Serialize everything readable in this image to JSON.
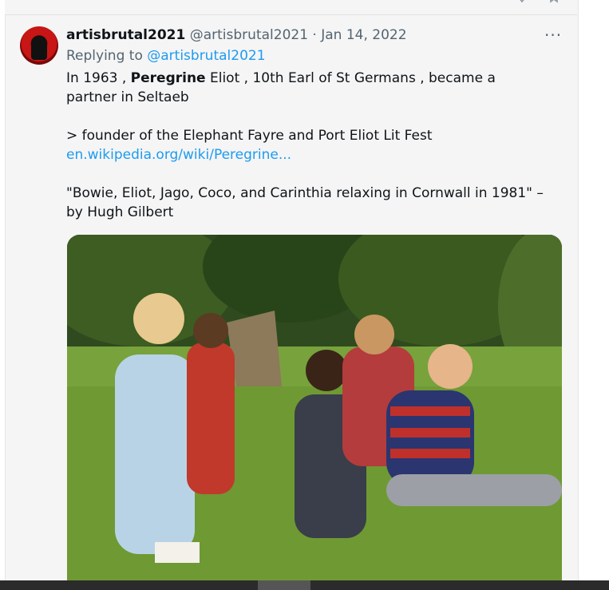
{
  "tweet": {
    "display_name": "artisbrutal2021",
    "handle": "@artisbrutal2021",
    "separator": "·",
    "date": "Jan 14, 2022",
    "reply_prefix": "Replying to",
    "reply_to": "@artisbrutal2021",
    "line1_pre": "In 1963 , ",
    "line1_bold": "Peregrine",
    "line1_post": " Eliot , 10th Earl of St Germans , became a partner in Seltaeb",
    "line2_text": "> founder of the Elephant Fayre and Port Eliot Lit Fest ",
    "line2_link": "en.wikipedia.org/wiki/Peregrine...",
    "line3": "\"Bowie, Eliot, Jago, Coco, and Carinthia relaxing in Cornwall in 1981\" – by Hugh Gilbert"
  },
  "icons": {
    "more": "more-options-icon",
    "avatar": "avatar"
  },
  "colors": {
    "link": "#1d9bf0",
    "muted": "#536471",
    "text": "#0f1419",
    "panel": "#f5f5f5"
  }
}
